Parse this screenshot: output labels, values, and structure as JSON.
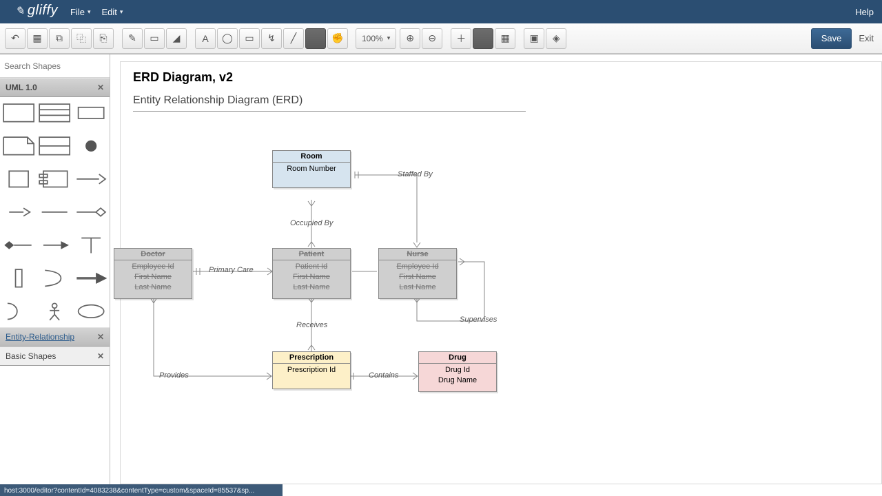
{
  "menubar": {
    "file": "File",
    "edit": "Edit",
    "help": "Help"
  },
  "logo": "gliffy",
  "toolbar": {
    "zoom": "100%",
    "save": "Save",
    "exit": "Exit"
  },
  "sidebar": {
    "search_placeholder": "Search Shapes",
    "panels": {
      "uml": "UML 1.0",
      "er": "Entity-Relationship",
      "basic": "Basic Shapes"
    }
  },
  "document": {
    "title": "ERD Diagram, v2",
    "subtitle": "Entity Relationship Diagram (ERD)"
  },
  "entities": {
    "room": {
      "name": "Room",
      "attrs": [
        "Room Number"
      ]
    },
    "doctor": {
      "name": "Doctor",
      "attrs": [
        "Employee Id",
        "First Name",
        "Last Name"
      ]
    },
    "patient": {
      "name": "Patient",
      "attrs": [
        "Patient Id",
        "First Name",
        "Last Name"
      ]
    },
    "nurse": {
      "name": "Nurse",
      "attrs": [
        "Employee Id",
        "First Name",
        "Last Name"
      ]
    },
    "prescription": {
      "name": "Prescription",
      "attrs": [
        "Prescription Id"
      ]
    },
    "drug": {
      "name": "Drug",
      "attrs": [
        "Drug Id",
        "Drug Name"
      ]
    }
  },
  "relations": {
    "staffed_by": "Staffed By",
    "occupied_by": "Occupied By",
    "primary_care": "Primary Care",
    "receives": "Receives",
    "provides": "Provides",
    "contains": "Contains",
    "supervises": "Supervises"
  },
  "status_url": "host:3000/editor?contentId=4083238&contentType=custom&spaceId=85537&sp..."
}
